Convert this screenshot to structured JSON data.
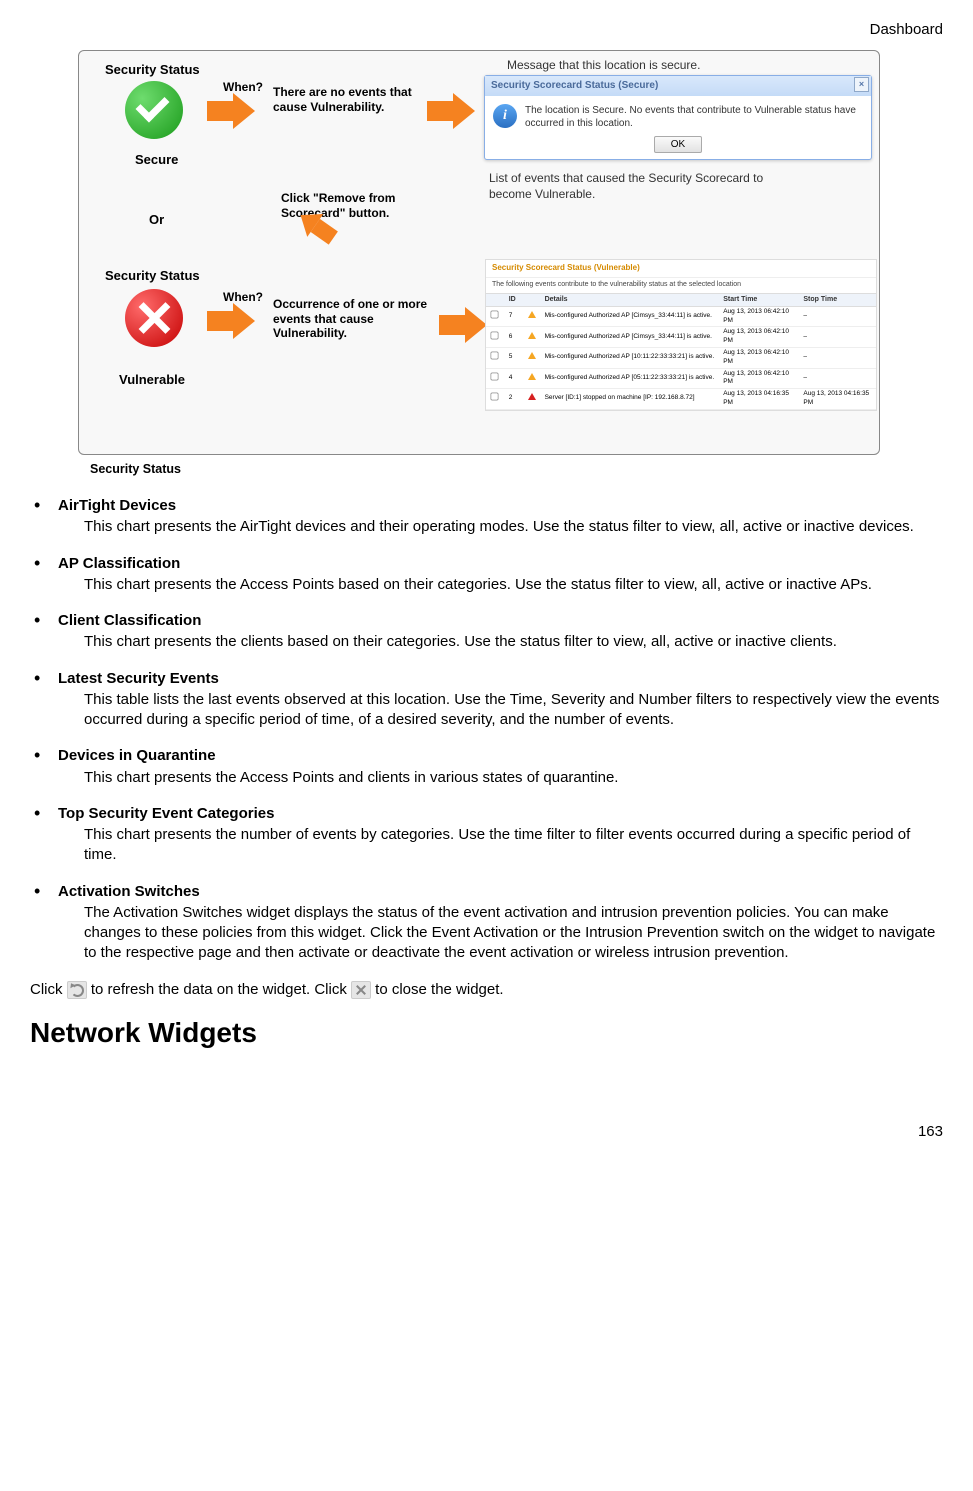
{
  "header": {
    "title": "Dashboard"
  },
  "figure_caption": "Security Status",
  "diagram": {
    "sec_status_1": "Security Status",
    "when1": "When?",
    "no_events": "There are no events that cause Vulnerability.",
    "secure_label": "Secure",
    "or_label": "Or",
    "sec_status_2": "Security Status",
    "when2": "When?",
    "occurrence": "Occurrence  of one or more events that cause Vulnerability.",
    "vulnerable_label": "Vulnerable",
    "click_remove": "Click \"Remove from Scorecard\" button.",
    "msg_secure": "Message that this location is secure.",
    "list_events": "List of events that caused the Security Scorecard to become Vulnerable.",
    "dialog": {
      "title": "Security Scorecard Status (Secure)",
      "body": "The location is Secure. No events that contribute to Vulnerable status have occurred in this location.",
      "ok": "OK"
    },
    "panel": {
      "title": "Security Scorecard Status (Vulnerable)",
      "subtitle": "The following events contribute to the vulnerability status at the selected location",
      "cols": {
        "id": "ID",
        "details": "Details",
        "start": "Start Time",
        "stop": "Stop Time"
      },
      "rows": [
        {
          "id": "7",
          "severity": "warn",
          "details": "Mis-configured Authorized AP [Cimsys_33:44:11] is active.",
          "start": "Aug 13, 2013 06:42:10 PM",
          "stop": "–"
        },
        {
          "id": "6",
          "severity": "warn",
          "details": "Mis-configured Authorized AP [Cimsys_33:44:11] is active.",
          "start": "Aug 13, 2013 06:42:10 PM",
          "stop": "–"
        },
        {
          "id": "5",
          "severity": "warn",
          "details": "Mis-configured Authorized AP [10:11:22:33:33:21] is active.",
          "start": "Aug 13, 2013 06:42:10 PM",
          "stop": "–"
        },
        {
          "id": "4",
          "severity": "warn",
          "details": "Mis-configured Authorized AP [05:11:22:33:33:21] is active.",
          "start": "Aug 13, 2013 06:42:10 PM",
          "stop": "–"
        },
        {
          "id": "2",
          "severity": "err",
          "details": "Server [ID:1] stopped on machine [IP: 192.168.8.72]",
          "start": "Aug 13, 2013 04:16:35 PM",
          "stop": "Aug 13, 2013 04:16:35 PM"
        }
      ]
    }
  },
  "items": [
    {
      "title": "AirTight Devices",
      "body": "This chart presents the AirTight devices and their operating modes. Use the status filter to view, all, active or inactive devices."
    },
    {
      "title": "AP Classification",
      "body": "This chart presents the Access Points based on their categories. Use the status filter to view, all, active or inactive APs."
    },
    {
      "title": "Client Classification",
      "body": "This chart presents the clients based on their categories. Use the status filter to view, all, active or inactive clients."
    },
    {
      "title": "Latest Security Events",
      "body": "This table lists the last events observed at this location. Use the Time, Severity and Number filters to respectively view the events occurred during a specific period of time, of a desired severity, and the number of events."
    },
    {
      "title": "Devices in Quarantine",
      "body": "This chart presents the Access Points and clients in various states of quarantine."
    },
    {
      "title": "Top Security Event Categories",
      "body": "This chart presents the number of events by categories. Use the time filter to filter events occurred during a specific period of time."
    },
    {
      "title": "Activation Switches",
      "body": "The Activation Switches widget displays the status of the event activation and intrusion prevention policies. You can make changes to these policies from this widget. Click the Event Activation or the Intrusion Prevention switch on the widget to navigate to the respective page and then activate or deactivate the event activation or wireless intrusion prevention."
    }
  ],
  "closing": {
    "p1a": "Click ",
    "p1b": "  to refresh the data on the widget. Click ",
    "p1c": "  to close the widget."
  },
  "section_heading": "Network Widgets",
  "page_number": "163"
}
